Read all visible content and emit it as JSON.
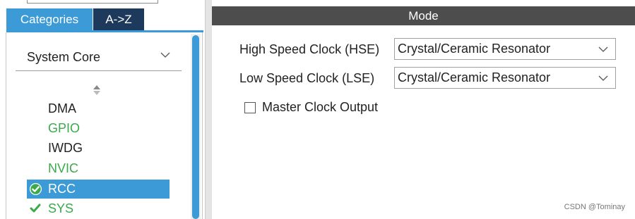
{
  "tabs": {
    "categories": "Categories",
    "az": "A->Z"
  },
  "category_select": {
    "value": "System Core"
  },
  "items": [
    {
      "label": "DMA",
      "status": "none"
    },
    {
      "label": "GPIO",
      "status": "none"
    },
    {
      "label": "IWDG",
      "status": "none"
    },
    {
      "label": "NVIC",
      "status": "none"
    },
    {
      "label": "RCC",
      "status": "configured",
      "selected": true
    },
    {
      "label": "SYS",
      "status": "configured"
    }
  ],
  "mode": {
    "header": "Mode",
    "hse_label": "High Speed Clock (HSE)",
    "hse_value": "Crystal/Ceramic Resonator",
    "lse_label": "Low Speed Clock (LSE)",
    "lse_value": "Crystal/Ceramic Resonator",
    "mco_label": "Master Clock Output",
    "mco_checked": false
  },
  "watermark": "CSDN @Tominay",
  "colors": {
    "accent": "#3c9ad6",
    "tab_dark": "#1d3a5c",
    "green": "#3aaa4b",
    "header": "#4d4d4d"
  }
}
